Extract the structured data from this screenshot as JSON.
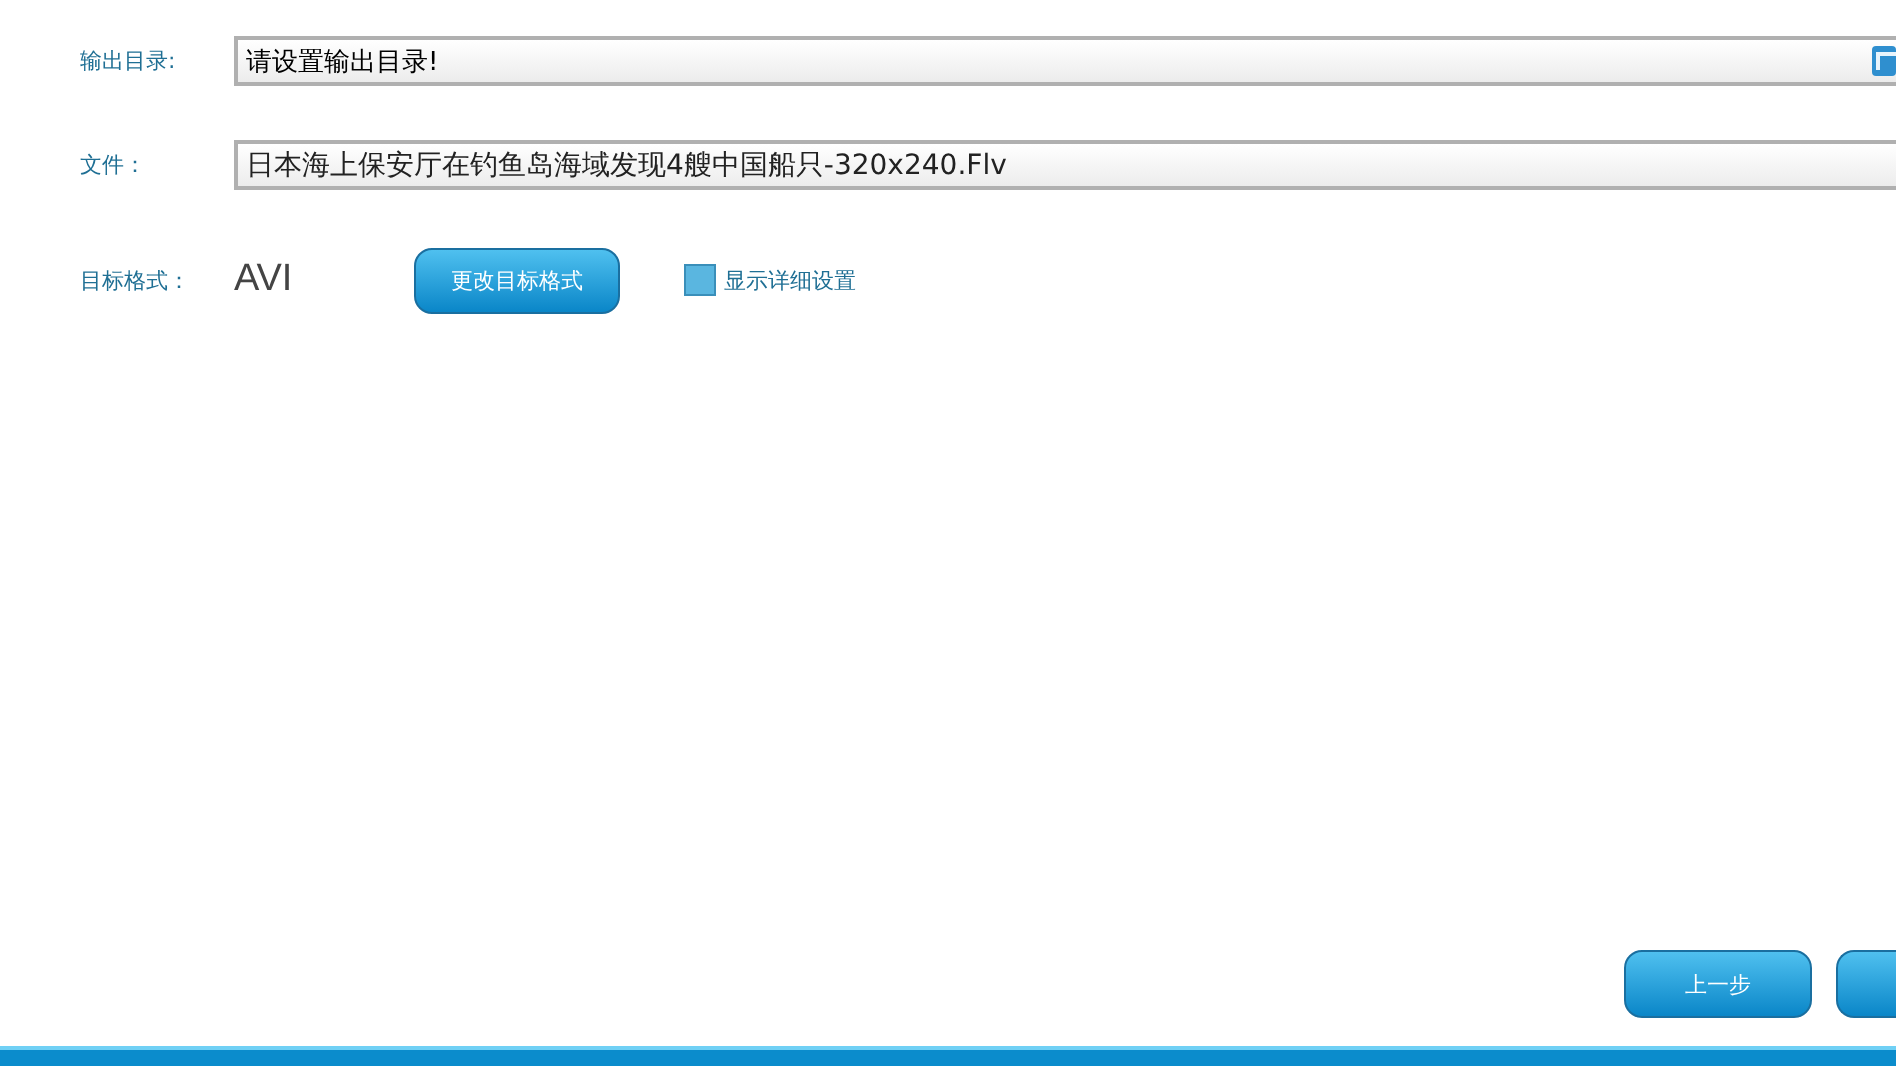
{
  "output_dir": {
    "label": "输出目录:",
    "value": "请设置输出目录!"
  },
  "file": {
    "label": "文件：",
    "value": "日本海上保安厅在钓鱼岛海域发现4艘中国船只-320x240.Flv"
  },
  "target_format": {
    "label": "目标格式：",
    "value": "AVI",
    "change_button": "更改目标格式"
  },
  "details_checkbox": {
    "label": "显示详细设置",
    "checked": false
  },
  "buttons": [
    {
      "label": "上一步"
    }
  ]
}
